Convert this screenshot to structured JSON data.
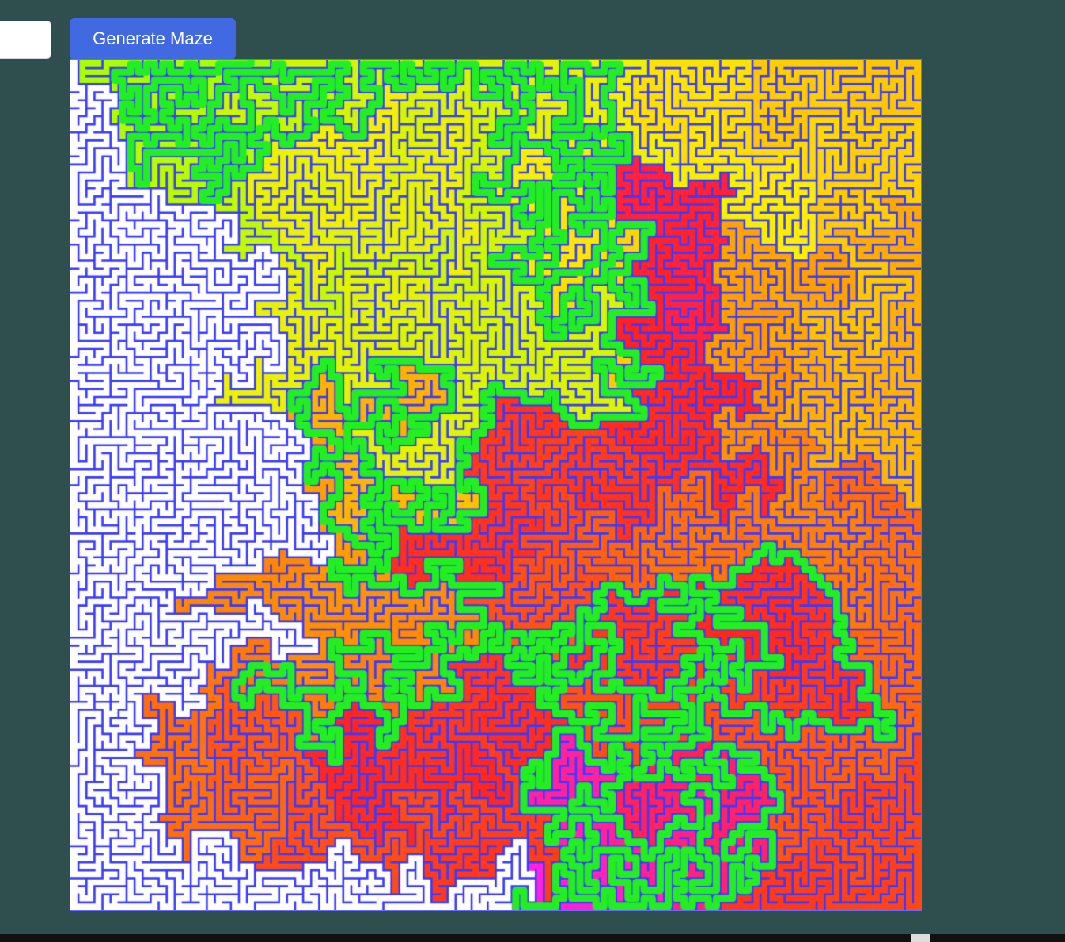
{
  "controls": {
    "size_input_value": "",
    "generate_label": "Generate Maze"
  },
  "maze": {
    "seed": 73,
    "cols": 106,
    "rows": 106,
    "wall_color": "#3a3aff",
    "background_color": "#ffffff",
    "path_color": "#22ee22",
    "heat_colors": [
      "#a6ff00",
      "#ffee00",
      "#ff9900",
      "#ff2222",
      "#ff22dd"
    ],
    "start_cell": [
      22,
      0
    ],
    "end_cell": [
      55,
      105
    ]
  },
  "colors": {
    "page_background": "#2f4f4f",
    "button_background": "#4169e1",
    "button_text": "#ffffff"
  }
}
